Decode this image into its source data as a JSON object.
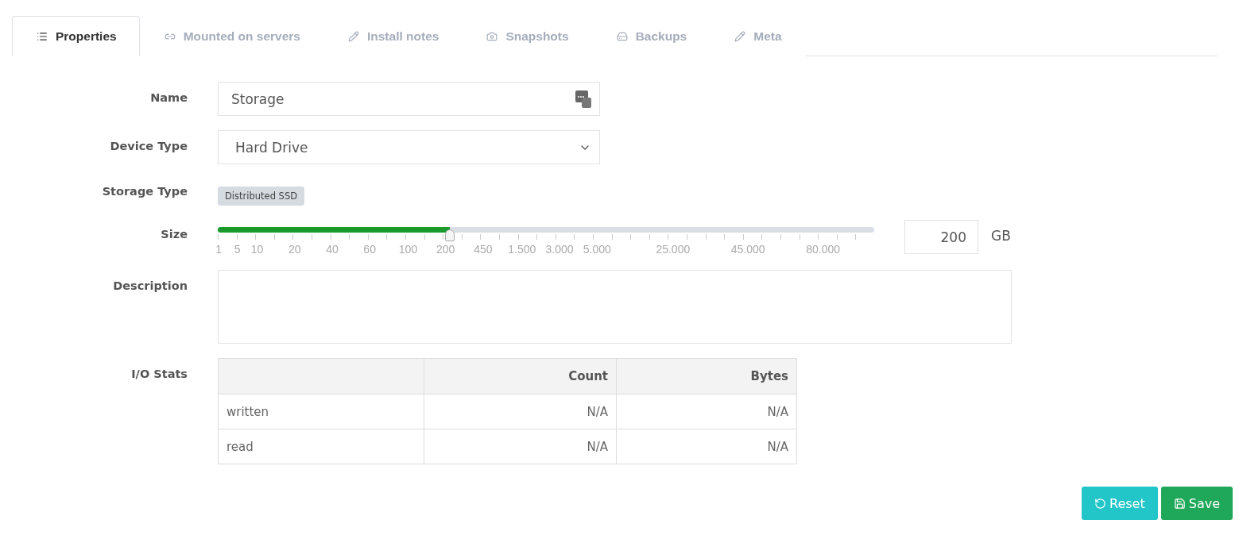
{
  "tabs": [
    {
      "label": "Properties",
      "selected": true
    },
    {
      "label": "Mounted on servers",
      "selected": false
    },
    {
      "label": "Install notes",
      "selected": false
    },
    {
      "label": "Snapshots",
      "selected": false
    },
    {
      "label": "Backups",
      "selected": false
    },
    {
      "label": "Meta",
      "selected": false
    }
  ],
  "form": {
    "name": {
      "label": "Name",
      "value": "Storage"
    },
    "device_type": {
      "label": "Device Type",
      "value": "Hard Drive"
    },
    "storage_type": {
      "label": "Storage Type",
      "badge": "Distributed SSD"
    },
    "size": {
      "label": "Size",
      "level": 0.354,
      "tick_labels": [
        "1",
        "5",
        "10",
        "20",
        "40",
        "60",
        "100",
        "200",
        "450",
        "1.500",
        "3.000",
        "5.000",
        "25.000",
        "45.000",
        "80.000"
      ],
      "value": "200",
      "unit": "GB"
    },
    "description": {
      "label": "Description"
    },
    "io_stats": {
      "label": "I/O Stats",
      "columns": [
        "Count",
        "Bytes"
      ],
      "rows": [
        {
          "name": "written",
          "cells": [
            "N/A",
            "N/A"
          ]
        },
        {
          "name": "read",
          "cells": [
            "N/A",
            "N/A"
          ]
        }
      ]
    }
  },
  "buttons": [
    {
      "label": "Reset",
      "kind": "reset"
    },
    {
      "label": "Save",
      "kind": "save"
    }
  ]
}
